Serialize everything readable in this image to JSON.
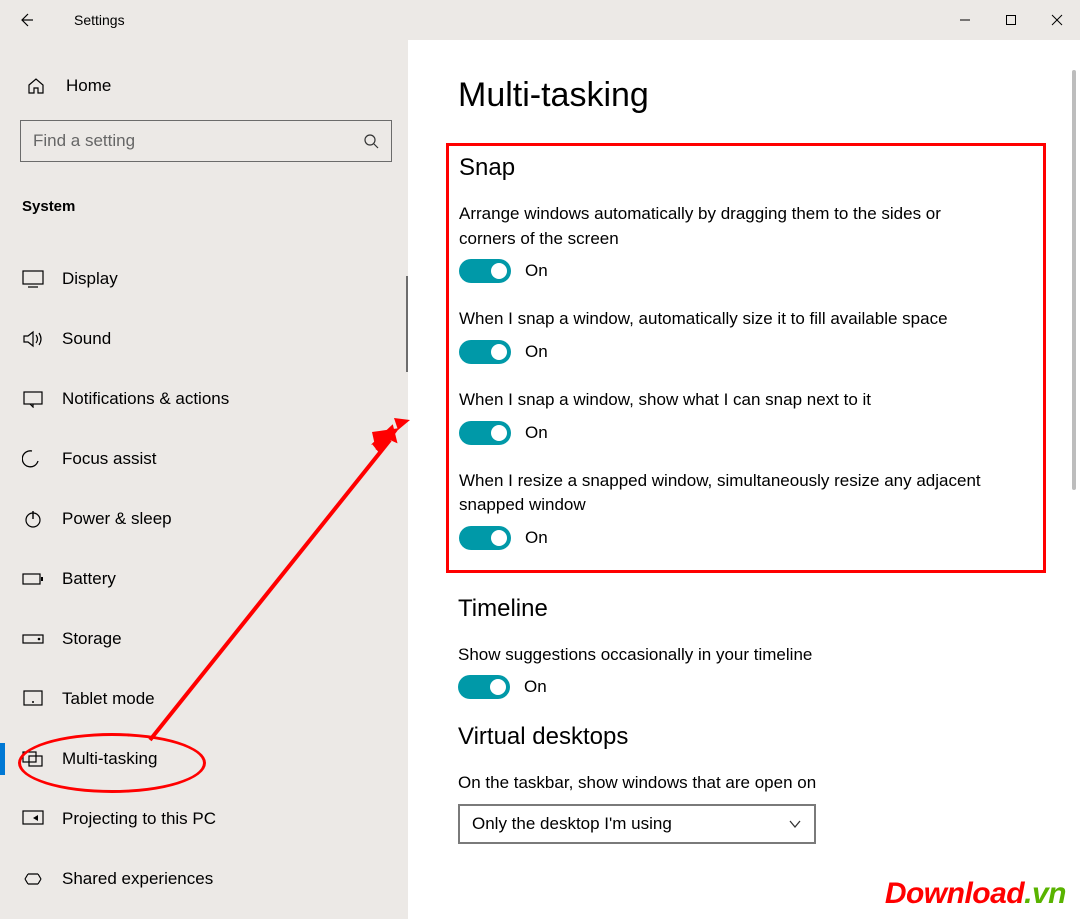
{
  "window": {
    "title": "Settings"
  },
  "sidebar": {
    "home": "Home",
    "search_placeholder": "Find a setting",
    "category": "System",
    "items": [
      {
        "label": "Display"
      },
      {
        "label": "Sound"
      },
      {
        "label": "Notifications & actions"
      },
      {
        "label": "Focus assist"
      },
      {
        "label": "Power & sleep"
      },
      {
        "label": "Battery"
      },
      {
        "label": "Storage"
      },
      {
        "label": "Tablet mode"
      },
      {
        "label": "Multi-tasking"
      },
      {
        "label": "Projecting to this PC"
      },
      {
        "label": "Shared experiences"
      }
    ]
  },
  "page": {
    "title": "Multi-tasking",
    "sections": {
      "snap": {
        "heading": "Snap",
        "s1": {
          "desc": "Arrange windows automatically by dragging them to the sides or corners of the screen",
          "state": "On"
        },
        "s2": {
          "desc": "When I snap a window, automatically size it to fill available space",
          "state": "On"
        },
        "s3": {
          "desc": "When I snap a window, show what I can snap next to it",
          "state": "On"
        },
        "s4": {
          "desc": "When I resize a snapped window, simultaneously resize any adjacent snapped window",
          "state": "On"
        }
      },
      "timeline": {
        "heading": "Timeline",
        "s1": {
          "desc": "Show suggestions occasionally in your timeline",
          "state": "On"
        }
      },
      "virtual_desktops": {
        "heading": "Virtual desktops",
        "s1": {
          "desc": "On the taskbar, show windows that are open on",
          "value": "Only the desktop I'm using"
        }
      }
    }
  },
  "watermark": {
    "a": "Download",
    "b": ".vn"
  }
}
